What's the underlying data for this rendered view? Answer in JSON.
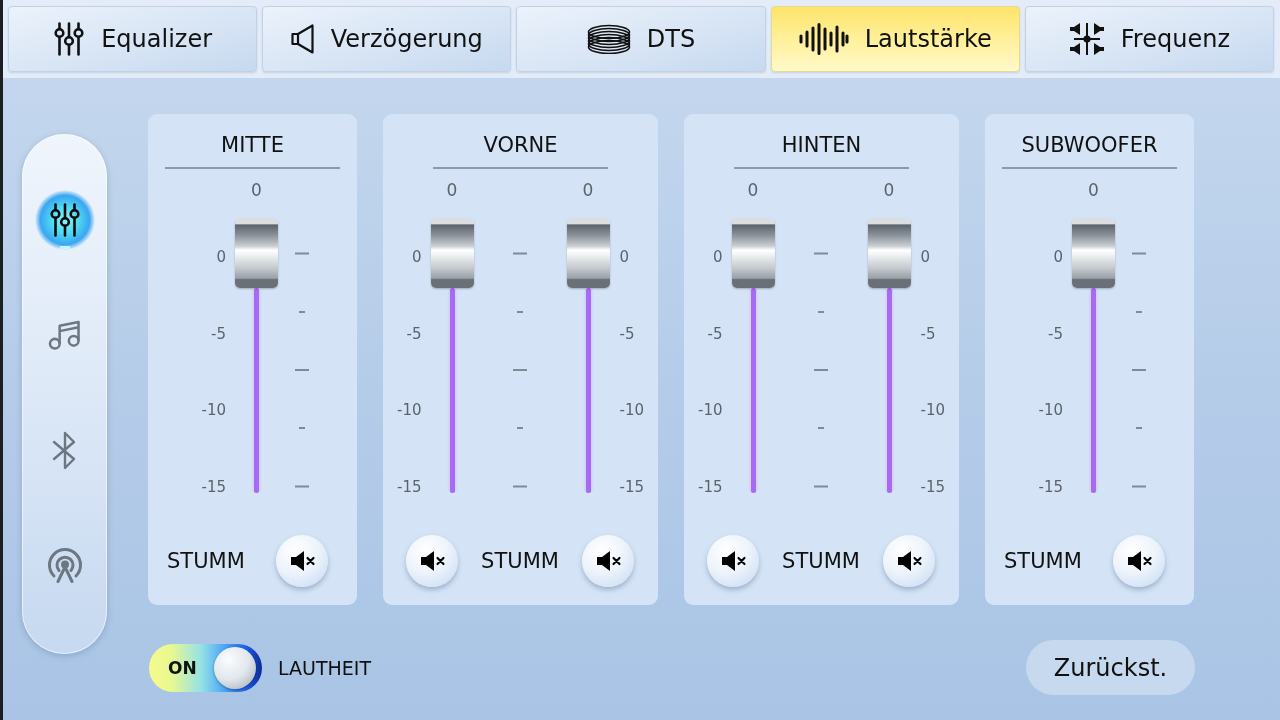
{
  "tabs": [
    {
      "label": "Equalizer",
      "selected": false
    },
    {
      "label": "Verzögerung",
      "selected": false
    },
    {
      "label": "DTS",
      "selected": false
    },
    {
      "label": "Lautstärke",
      "selected": true
    },
    {
      "label": "Frequenz",
      "selected": false
    }
  ],
  "sidebar": {
    "items": [
      {
        "selected": true
      },
      {
        "selected": false
      },
      {
        "selected": false
      },
      {
        "selected": false
      }
    ]
  },
  "groups": [
    {
      "title": "MITTE",
      "channels": [
        {
          "value": "0",
          "level": 1,
          "scale": [
            "0",
            "-5",
            "-10",
            "-15"
          ]
        }
      ],
      "mute_label": "STUMM"
    },
    {
      "title": "VORNE",
      "channels": [
        {
          "value": "0",
          "level": 1,
          "scale": [
            "0",
            "-5",
            "-10",
            "-15"
          ]
        },
        {
          "value": "0",
          "level": 1,
          "scale": [
            "0",
            "-5",
            "-10",
            "-15"
          ]
        }
      ],
      "mute_label": "STUMM"
    },
    {
      "title": "HINTEN",
      "channels": [
        {
          "value": "0",
          "level": 1,
          "scale": [
            "0",
            "-5",
            "-10",
            "-15"
          ]
        },
        {
          "value": "0",
          "level": 1,
          "scale": [
            "0",
            "-5",
            "-10",
            "-15"
          ]
        }
      ],
      "mute_label": "STUMM"
    },
    {
      "title": "SUBWOOFER",
      "channels": [
        {
          "value": "0",
          "level": 1,
          "scale": [
            "0",
            "-5",
            "-10",
            "-15"
          ]
        }
      ],
      "mute_label": "STUMM"
    }
  ],
  "loudness": {
    "switch_text": "ON",
    "on": true,
    "label": "LAUTHEIT"
  },
  "reset_button": "Zurückst."
}
